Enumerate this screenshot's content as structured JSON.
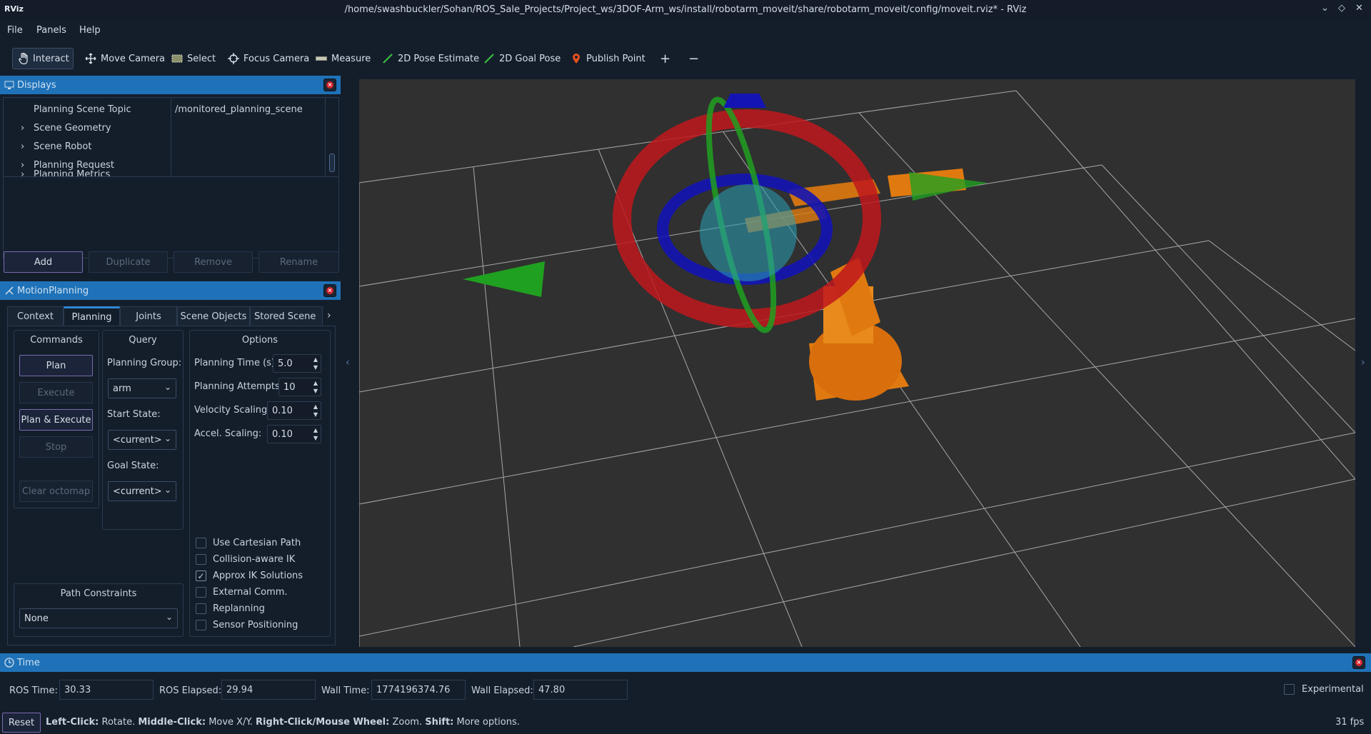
{
  "window": {
    "logo": "RViz",
    "title": "/home/swashbuckler/Sohan/ROS_Sale_Projects/Project_ws/3DOF-Arm_ws/install/robotarm_moveit/share/robotarm_moveit/config/moveit.rviz* - RViz"
  },
  "menu": [
    "File",
    "Panels",
    "Help"
  ],
  "toolbar": {
    "interact": "Interact",
    "move_camera": "Move Camera",
    "select": "Select",
    "focus_camera": "Focus Camera",
    "measure": "Measure",
    "pose_estimate": "2D Pose Estimate",
    "goal_pose": "2D Goal Pose",
    "publish_point": "Publish Point"
  },
  "displays": {
    "header": "Displays",
    "rows": [
      {
        "label": "Planning Scene Topic",
        "value": "/monitored_planning_scene"
      },
      {
        "label": "Scene Geometry",
        "value": ""
      },
      {
        "label": "Scene Robot",
        "value": ""
      },
      {
        "label": "Planning Request",
        "value": ""
      },
      {
        "label": "Planning Metrics",
        "value": ""
      }
    ],
    "buttons": {
      "add": "Add",
      "duplicate": "Duplicate",
      "remove": "Remove",
      "rename": "Rename"
    }
  },
  "motion": {
    "header": "MotionPlanning",
    "tabs": [
      "Context",
      "Planning",
      "Joints",
      "Scene Objects",
      "Stored Scene"
    ],
    "active_tab": "Planning",
    "commands": {
      "title": "Commands",
      "plan": "Plan",
      "execute": "Execute",
      "plan_execute": "Plan & Execute",
      "stop": "Stop",
      "clear_octomap": "Clear octomap"
    },
    "query": {
      "title": "Query",
      "planning_group_label": "Planning Group:",
      "planning_group": "arm",
      "start_state_label": "Start State:",
      "start_state": "<current>",
      "goal_state_label": "Goal State:",
      "goal_state": "<current>"
    },
    "options": {
      "title": "Options",
      "planning_time_label": "Planning Time (s):",
      "planning_time": "5.0",
      "planning_attempts_label": "Planning Attempts:",
      "planning_attempts": "10",
      "velocity_scaling_label": "Velocity Scaling:",
      "velocity_scaling": "0.10",
      "accel_scaling_label": "Accel. Scaling:",
      "accel_scaling": "0.10",
      "checkboxes": [
        {
          "label": "Use Cartesian Path",
          "checked": false
        },
        {
          "label": "Collision-aware IK",
          "checked": false
        },
        {
          "label": "Approx IK Solutions",
          "checked": true
        },
        {
          "label": "External Comm.",
          "checked": false
        },
        {
          "label": "Replanning",
          "checked": false
        },
        {
          "label": "Sensor Positioning",
          "checked": false
        }
      ]
    },
    "path_constraints": {
      "title": "Path Constraints",
      "value": "None"
    }
  },
  "time": {
    "header": "Time",
    "ros_time_label": "ROS Time:",
    "ros_time": "30.33",
    "ros_elapsed_label": "ROS Elapsed:",
    "ros_elapsed": "29.94",
    "wall_time_label": "Wall Time:",
    "wall_time": "1774196374.76",
    "wall_elapsed_label": "Wall Elapsed:",
    "wall_elapsed": "47.80",
    "experimental": "Experimental"
  },
  "status": {
    "reset": "Reset",
    "left_click": "Left-Click:",
    "left_click_desc": "Rotate.",
    "middle_click": "Middle-Click:",
    "middle_click_desc": "Move X/Y.",
    "right_click": "Right-Click/Mouse Wheel:",
    "right_click_desc": "Zoom.",
    "shift": "Shift:",
    "shift_desc": "More options.",
    "fps": "31 fps"
  },
  "colors": {
    "accent": "#1f72b8",
    "viewport_bg": "#303030",
    "robot": "#e07a10",
    "ring_red": "#c0181c",
    "ring_blue": "#1414b4",
    "ring_green": "#20a020"
  }
}
